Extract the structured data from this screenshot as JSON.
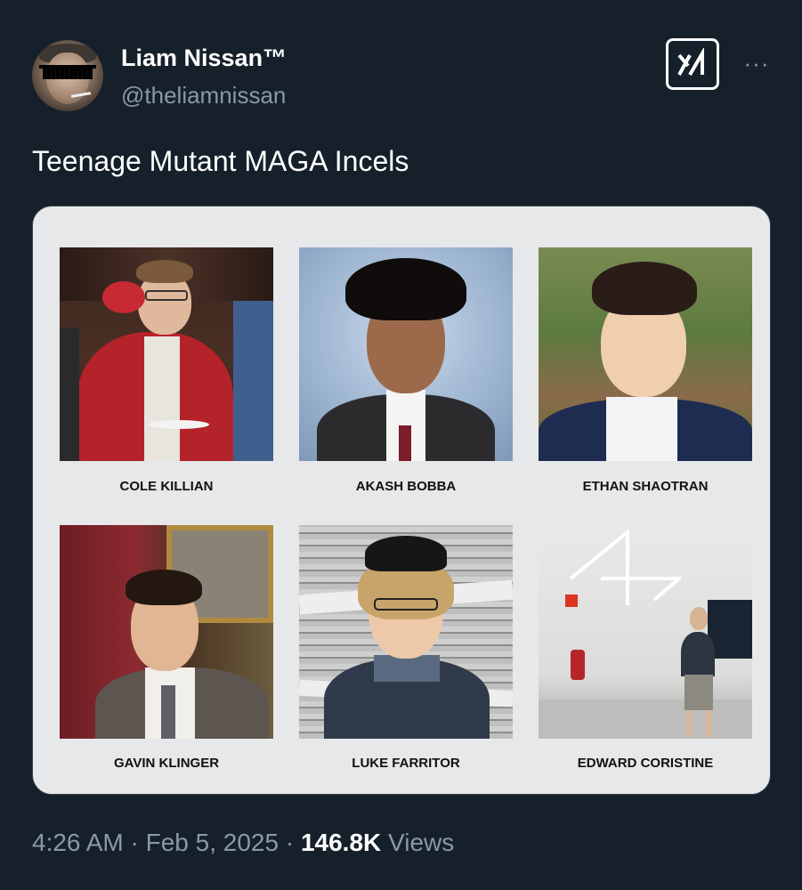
{
  "author": {
    "display_name": "Liam Nissan™",
    "handle": "@theliamnissan",
    "avatar_icon": "avatar-photo"
  },
  "header": {
    "grok_icon": "grok-logo-icon",
    "more_icon": "more-horizontal-icon",
    "more_label": "···"
  },
  "tweet": {
    "text": "Teenage Mutant MAGA Incels"
  },
  "media": {
    "people": [
      {
        "name": "COLE KILLIAN"
      },
      {
        "name": "AKASH BOBBA"
      },
      {
        "name": "ETHAN SHAOTRAN"
      },
      {
        "name": "GAVIN KLINGER"
      },
      {
        "name": "LUKE FARRITOR"
      },
      {
        "name": "EDWARD CORISTINE"
      }
    ]
  },
  "meta": {
    "time": "4:26 AM",
    "sep1": "·",
    "date": "Feb 5, 2025",
    "sep2": "·",
    "views_count": "146.8K",
    "views_label": "Views"
  },
  "colors": {
    "background": "#15202b",
    "primary_text": "#ffffff",
    "secondary_text": "#8b98a5",
    "media_background": "#e7e8ea"
  }
}
